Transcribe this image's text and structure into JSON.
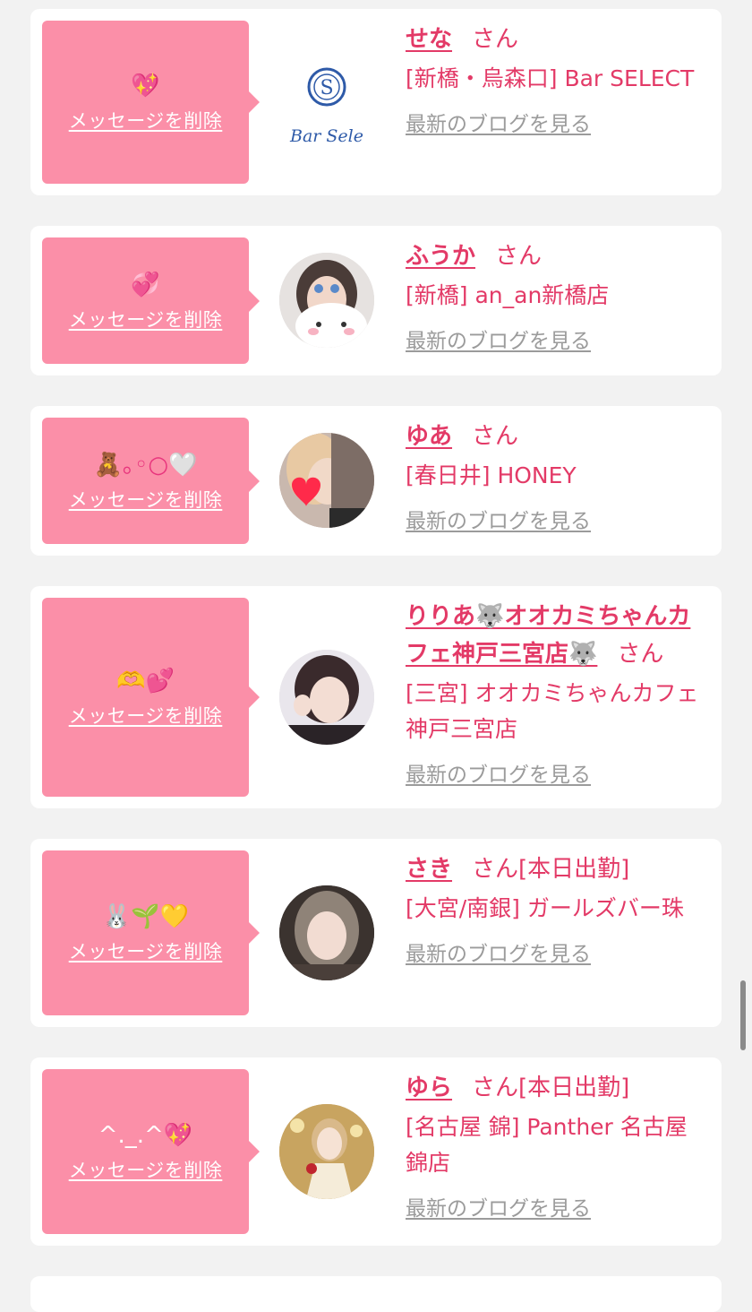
{
  "delete_label": "メッセージを削除",
  "honorific": "さん",
  "blog_link_label": "最新のブログを見る",
  "cards": [
    {
      "emoji": "💖",
      "name": "せな",
      "status": "",
      "shop": "[新橋・烏森口] Bar SELECT",
      "avatar_logo": "Bar Sele",
      "avatar_letter": "S"
    },
    {
      "emoji": "💞",
      "name": "ふうか",
      "status": "",
      "shop": "[新橋] an_an新橋店"
    },
    {
      "emoji": "🧸｡◦○🤍",
      "name": "ゆあ",
      "status": "",
      "shop": "[春日井] HONEY"
    },
    {
      "emoji": "🫶💕",
      "name": "りりあ🐺オオカミちゃんカフェ神戸三宮店🐺",
      "status": "",
      "shop": "[三宮] オオカミちゃんカフェ神戸三宮店"
    },
    {
      "emoji": "🐰🌱💛",
      "name": "さき",
      "status": "[本日出勤]",
      "shop": "[大宮/南銀] ガールズバー珠"
    },
    {
      "emoji": "^._.^💖",
      "name": "ゆら",
      "status": "[本日出勤]",
      "shop": "[名古屋 錦] Panther 名古屋錦店"
    }
  ],
  "colors": {
    "accent": "#e33a67",
    "bubble": "#fb8fa8",
    "background": "#f2f2f2",
    "muted": "#9b9b9b"
  }
}
